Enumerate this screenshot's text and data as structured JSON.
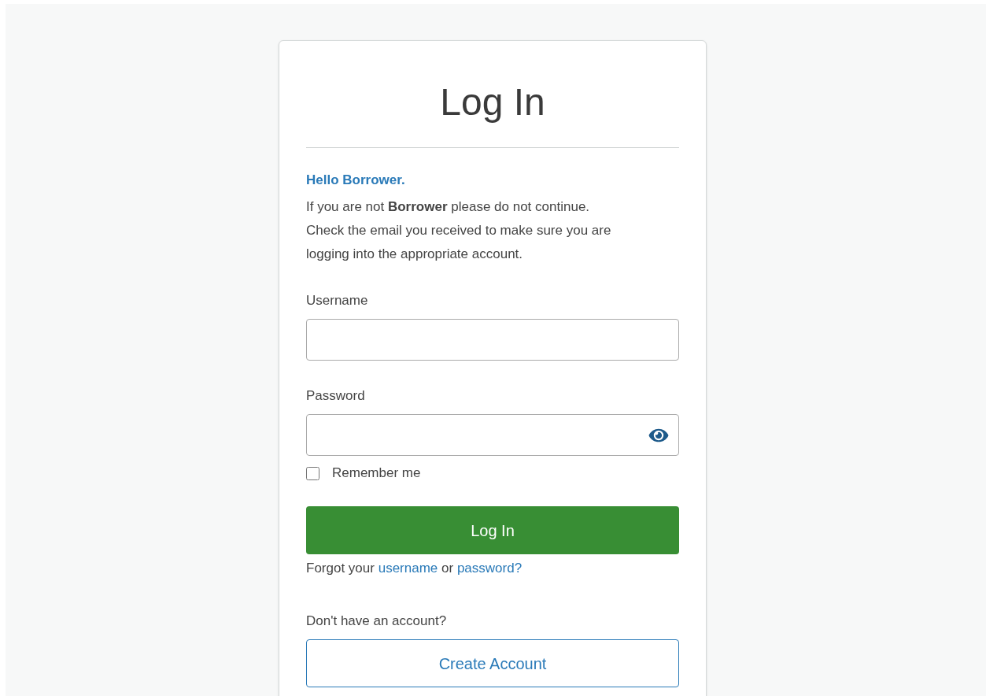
{
  "title": "Log In",
  "greeting": "Hello Borrower.",
  "notice_lines": [
    "If you are not **Borrower** please do not continue.",
    "Check the email you received to make sure you are",
    "logging into the appropriate account."
  ],
  "fields": [
    {
      "label": "Username",
      "kind": "text"
    },
    {
      "label": "Password",
      "kind": "password"
    }
  ],
  "remember": {
    "label": "Remember me",
    "checked": false
  },
  "submit": "Log In",
  "forgot": {
    "prefix": "Forgot your",
    "username_link": "username",
    "middle": "or",
    "password_link": "password?"
  },
  "signup": {
    "prompt": "Don't have an account?",
    "button": "Create Account"
  }
}
